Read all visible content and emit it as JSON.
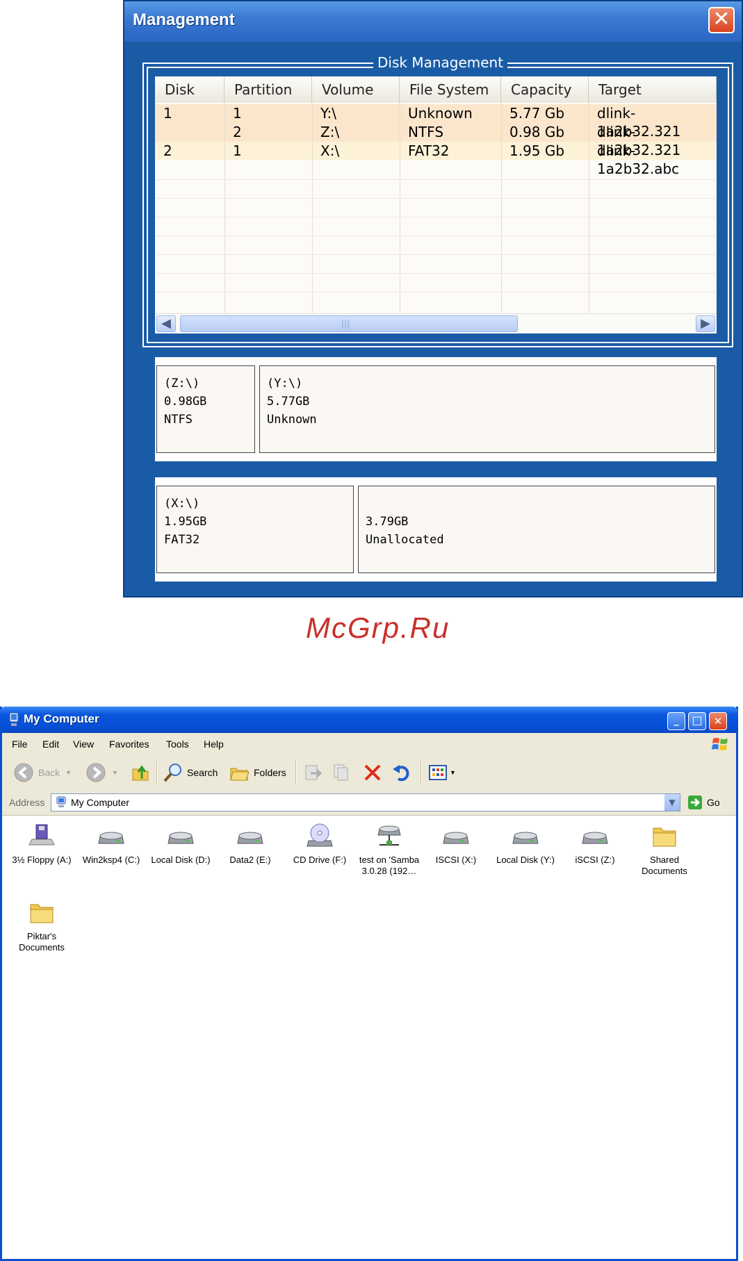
{
  "management": {
    "title": "Management",
    "close_glyph": "✕",
    "group_title": "Disk Management",
    "columns": [
      "Disk",
      "Partition",
      "Volume",
      "File System",
      "Capacity",
      "Target"
    ],
    "rows": [
      {
        "disk": "1",
        "partition": "1",
        "volume": "Y:\\",
        "fs": "Unknown",
        "capacity": "5.77 Gb",
        "target": "dlink-1a2b32.321"
      },
      {
        "disk": "",
        "partition": "2",
        "volume": "Z:\\",
        "fs": "NTFS",
        "capacity": "0.98 Gb",
        "target": "dlink-1a2b32.321"
      },
      {
        "disk": "2",
        "partition": "1",
        "volume": "X:\\",
        "fs": "FAT32",
        "capacity": "1.95 Gb",
        "target": "dlink-1a2b32.abc"
      }
    ],
    "disk1_parts": [
      {
        "volume": "(Z:\\)",
        "size": "0.98GB",
        "fs": "NTFS"
      },
      {
        "volume": "(Y:\\)",
        "size": "5.77GB",
        "fs": "Unknown"
      }
    ],
    "disk2_parts": [
      {
        "volume": "(X:\\)",
        "size": "1.95GB",
        "fs": "FAT32"
      },
      {
        "volume": "",
        "size": "3.79GB",
        "fs": "Unallocated"
      }
    ],
    "scroll_left": "◀",
    "scroll_right": "▶",
    "scroll_grip": "|||"
  },
  "watermark": "McGrp.Ru",
  "mycomputer": {
    "title": "My Computer",
    "window_controls": {
      "minimize": "_",
      "maximize": "□",
      "close": "✕"
    },
    "menu": [
      "File",
      "Edit",
      "View",
      "Favorites",
      "Tools",
      "Help"
    ],
    "toolbar": {
      "back": "Back",
      "search": "Search",
      "folders": "Folders"
    },
    "address_label": "Address",
    "address_value": "My Computer",
    "go_label": "Go",
    "items": [
      {
        "label": "3½ Floppy (A:)",
        "icon": "floppy-icon"
      },
      {
        "label": "Win2ksp4 (C:)",
        "icon": "drive-icon"
      },
      {
        "label": "Local Disk (D:)",
        "icon": "drive-icon"
      },
      {
        "label": "Data2 (E:)",
        "icon": "drive-icon"
      },
      {
        "label": "CD Drive (F:)",
        "icon": "cd-drive-icon"
      },
      {
        "label": "test on 'Samba 3.0.28 (192…",
        "icon": "network-drive-icon"
      },
      {
        "label": "ISCSI (X:)",
        "icon": "drive-icon"
      },
      {
        "label": "Local Disk (Y:)",
        "icon": "drive-icon"
      },
      {
        "label": "iSCSI (Z:)",
        "icon": "drive-icon"
      },
      {
        "label": "Shared Documents",
        "icon": "folder-icon"
      },
      {
        "label": "Piktar's Documents",
        "icon": "folder-icon"
      }
    ]
  }
}
